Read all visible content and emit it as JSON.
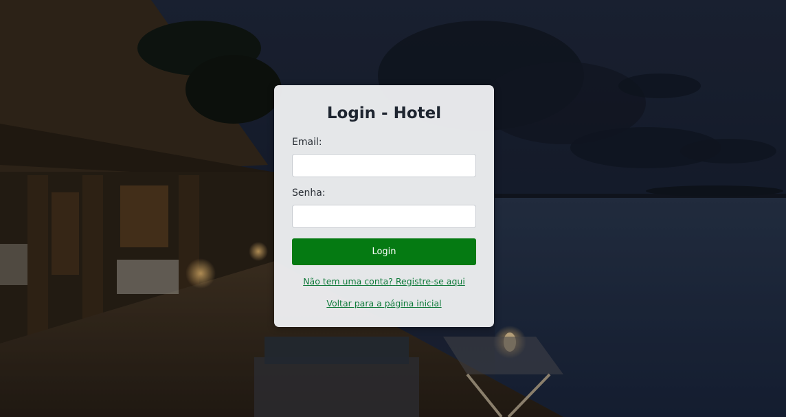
{
  "page": {
    "title": "Login - Hotel"
  },
  "form": {
    "email_label": "Email:",
    "email_value": "",
    "email_placeholder": "",
    "password_label": "Senha:",
    "password_value": "",
    "password_placeholder": "",
    "submit_label": "Login"
  },
  "links": {
    "register_prefix": "Não tem uma conta?",
    "register_text": "Registre-se aqui",
    "back_text": "Voltar para a página inicial"
  },
  "colors": {
    "button_bg": "#057a12",
    "link": "#0f7a3a",
    "card_bg": "#eeeff1",
    "night_sky": "#1b2438"
  }
}
